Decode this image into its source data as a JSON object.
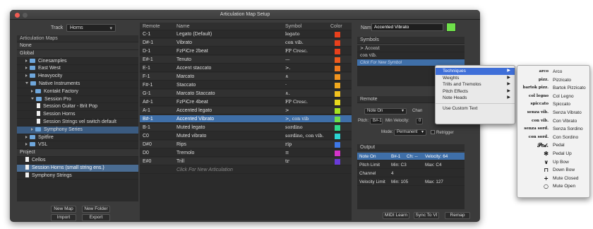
{
  "window": {
    "title": "Articulation Map Setup"
  },
  "left": {
    "track_label": "Track",
    "track_value": "Horns",
    "maps_header": "Articulation Maps",
    "tree": [
      {
        "label": "None",
        "kind": "group",
        "icon": "none",
        "depth": 0
      },
      {
        "label": "Global",
        "kind": "group",
        "icon": "none",
        "depth": 0
      },
      {
        "label": "Cinesamples",
        "kind": "folder",
        "icon": "folder-icon",
        "depth": 1,
        "expand": "closed"
      },
      {
        "label": "East West",
        "kind": "folder",
        "icon": "folder-icon",
        "depth": 1,
        "expand": "closed"
      },
      {
        "label": "Heavyocity",
        "kind": "folder",
        "icon": "folder-icon",
        "depth": 1,
        "expand": "closed"
      },
      {
        "label": "Native Instruments",
        "kind": "folder",
        "icon": "folder-icon",
        "depth": 1,
        "expand": "open"
      },
      {
        "label": "Kontakt Factory",
        "kind": "folder",
        "icon": "folder-icon",
        "depth": 2,
        "expand": "closed"
      },
      {
        "label": "Session Pro",
        "kind": "folder",
        "icon": "folder-icon",
        "depth": 2,
        "expand": "open"
      },
      {
        "label": "Session Guitar - Brit Pop",
        "kind": "doc",
        "icon": "document-icon",
        "depth": 3
      },
      {
        "label": "Session Horns",
        "kind": "doc",
        "icon": "document-icon",
        "depth": 3
      },
      {
        "label": "Session Strings vel switch default",
        "kind": "doc",
        "icon": "document-icon",
        "depth": 3
      },
      {
        "label": "Symphony Series",
        "kind": "folder",
        "icon": "folder-icon",
        "depth": 2,
        "expand": "closed",
        "state": "sel"
      },
      {
        "label": "Spitfire",
        "kind": "folder",
        "icon": "folder-icon",
        "depth": 1,
        "expand": "closed"
      },
      {
        "label": "VSL",
        "kind": "folder",
        "icon": "folder-icon",
        "depth": 1,
        "expand": "closed"
      },
      {
        "label": "Project",
        "kind": "group",
        "icon": "none",
        "depth": 0
      },
      {
        "label": "Cellos",
        "kind": "doc",
        "icon": "document-icon",
        "depth": 1
      },
      {
        "label": "Session Horns (small string ens.)",
        "kind": "doc",
        "icon": "document-icon",
        "depth": 1,
        "state": "light"
      },
      {
        "label": "Symphony Strings",
        "kind": "doc",
        "icon": "document-icon",
        "depth": 1
      }
    ],
    "buttons": {
      "new_map": "New Map",
      "new_folder": "New Folder",
      "import": "Import",
      "export": "Export"
    }
  },
  "table": {
    "headers": {
      "remote": "Remote",
      "name": "Name",
      "symbol": "Symbol",
      "color": "Color"
    },
    "rows": [
      {
        "remote": "C-1",
        "name": "Legato (Default)",
        "symbol": "legato",
        "color": "#e8401c"
      },
      {
        "remote": "D#-1",
        "name": "Vibrato",
        "symbol": "con vib.",
        "color": "#e8401c"
      },
      {
        "remote": "D-1",
        "name": "FzPiCre 2beat",
        "symbol": "FP Cresc.",
        "color": "#e8401c"
      },
      {
        "remote": "E#-1",
        "name": "Tenuto",
        "symbol": "—",
        "color": "#ee5a1e"
      },
      {
        "remote": "E-1",
        "name": "Accent staccato",
        "symbol": ">.",
        "color": "#f07a1f"
      },
      {
        "remote": "F-1",
        "name": "Marcato",
        "symbol": "∧",
        "color": "#f2941e"
      },
      {
        "remote": "F#-1",
        "name": "Staccato",
        "symbol": "·",
        "color": "#f2a91e"
      },
      {
        "remote": "G-1",
        "name": "Marcato Staccato",
        "symbol": "∧.",
        "color": "#f3c21e"
      },
      {
        "remote": "A#-1",
        "name": "FzPiCre 4beat",
        "symbol": "FP Cresc.",
        "color": "#e8d81d"
      },
      {
        "remote": "A-1",
        "name": "Accented legato",
        "symbol": ">",
        "color": "#a5e31f"
      },
      {
        "remote": "B#-1",
        "name": "Accented Vibrato",
        "symbol": ">, con vib",
        "color": "#6fe04a"
      },
      {
        "remote": "B-1",
        "name": "Muted legato",
        "symbol": "sordino",
        "color": "#2fdc8c"
      },
      {
        "remote": "C0",
        "name": "Muted vibrato",
        "symbol": "sordino, con vib.",
        "color": "#2bd4d4"
      },
      {
        "remote": "D#0",
        "name": "Rips",
        "symbol": "rip",
        "color": "#3e78e8"
      },
      {
        "remote": "D0",
        "name": "Tremolo",
        "symbol": "≡",
        "color": "#d333c9"
      },
      {
        "remote": "E#0",
        "name": "Trill",
        "symbol": "tr",
        "color": "#6a3bd8"
      }
    ],
    "selected_row": 10,
    "add_hint": "Click For New Articulation"
  },
  "right": {
    "name_label": "Name",
    "name_value": "Accented Vibrato",
    "name_color": "#6fe04a",
    "symbols_header": "Symbols",
    "symbols": [
      ">  Accent",
      "con vib.",
      "Click For New Symbol"
    ],
    "remote_header": "Remote",
    "remote_type": "Note On",
    "remote_channel_label": "Chan",
    "pitch_label": "Pitch:",
    "pitch_value": "B#-1",
    "min_vel_label": "Min Velocity:",
    "min_vel_value": "0",
    "mode_label": "Mode:",
    "mode_value": "Permanent",
    "retrigger_label": "Retrigger",
    "output_header": "Output",
    "output_rows": [
      {
        "a": "Note On",
        "b": "B#-1",
        "c": "Ch: --",
        "d": "Velocity: 64"
      },
      {
        "a": "Pitch Limit",
        "b": "Min: C3",
        "c": "",
        "d": "Max: C4"
      },
      {
        "a": "Channel",
        "b": "4",
        "c": "",
        "d": ""
      },
      {
        "a": "Velocity Limit",
        "b": "Min: 105",
        "c": "",
        "d": "Max: 127"
      }
    ],
    "buttons": {
      "midi_learn": "MIDI Learn",
      "sync_to_vi": "Sync To VI",
      "remap": "Remap"
    }
  },
  "context_menu": {
    "items": [
      {
        "label": "Techniques",
        "submenu": true,
        "highlight": true
      },
      {
        "label": "Weights",
        "submenu": true
      },
      {
        "label": "Trills and Tremolos",
        "submenu": true
      },
      {
        "label": "Pitch Effects",
        "submenu": true
      },
      {
        "label": "Note Heads",
        "submenu": true
      }
    ],
    "extra": "Use Custom Text"
  },
  "submenu": {
    "items": [
      {
        "glyph": "arco",
        "label": "Arco"
      },
      {
        "glyph": "pizz.",
        "label": "Pizzicato"
      },
      {
        "glyph": "bartok pizz.",
        "label": "Bartok Pizzicato"
      },
      {
        "glyph": "col legno",
        "label": "Col Legno"
      },
      {
        "glyph": "spiccato",
        "label": "Spiccato"
      },
      {
        "glyph": "senza vib.",
        "label": "Senza Vibrato"
      },
      {
        "glyph": "con vib.",
        "label": "Con Vibrato"
      },
      {
        "glyph": "senza sord.",
        "label": "Senza Sordino"
      },
      {
        "glyph": "con sord.",
        "label": "Con Sordino"
      },
      {
        "glyph": "𝒫𝑒𝒹.",
        "label": "Pedal",
        "big": true
      },
      {
        "glyph": "✻",
        "label": "Pedal Up",
        "big": true
      },
      {
        "glyph": "∨",
        "label": "Up Bow",
        "big": true
      },
      {
        "glyph": "⊓",
        "label": "Down Bow",
        "big": true
      },
      {
        "glyph": "+",
        "label": "Mute Closed",
        "big": true
      },
      {
        "glyph": "○",
        "label": "Mute Open",
        "big": true
      }
    ]
  }
}
